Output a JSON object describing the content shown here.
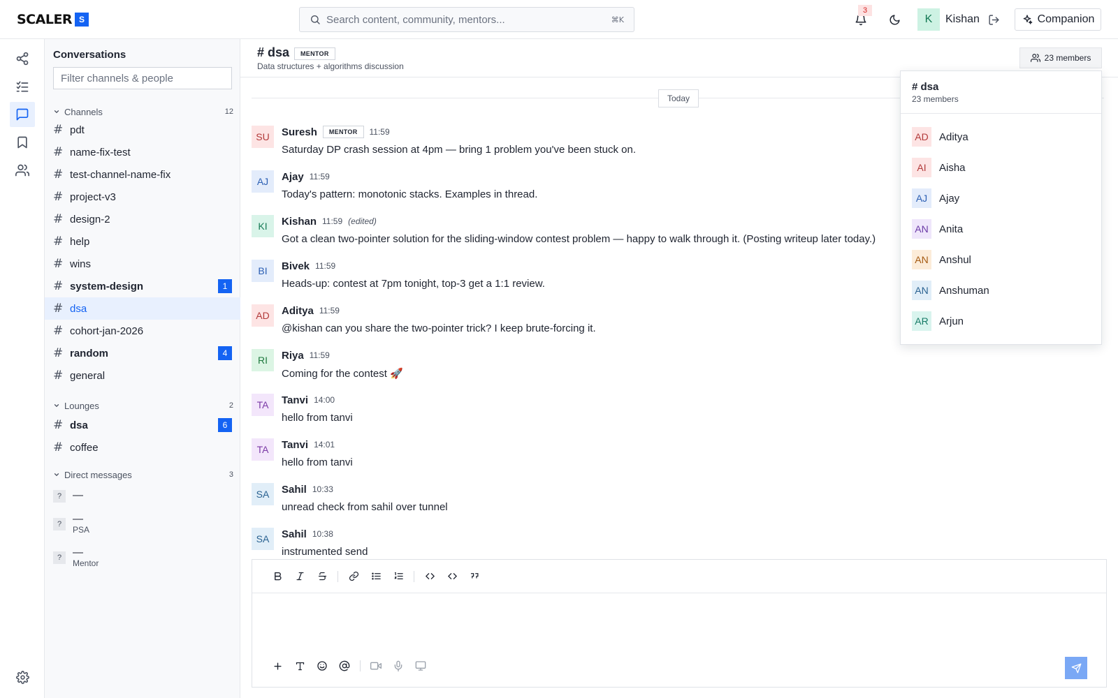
{
  "brand": {
    "name": "SCALER",
    "badge": "S",
    "accent": "#1463f3"
  },
  "search": {
    "placeholder": "Search content, community, mentors...",
    "shortcut": "⌘K"
  },
  "notifications": {
    "count": "3"
  },
  "user": {
    "initial": "K",
    "name": "Kishan"
  },
  "companion": {
    "label": "Companion"
  },
  "rail": {
    "items": [
      {
        "icon": "share-icon"
      },
      {
        "icon": "checklist-icon"
      },
      {
        "icon": "chat-icon",
        "active": true
      },
      {
        "icon": "bookmark-icon"
      },
      {
        "icon": "people-icon"
      }
    ],
    "settings_icon": "gear-icon"
  },
  "sidebar": {
    "title": "Conversations",
    "filter_placeholder": "Filter channels & people",
    "channels_section": {
      "label": "Channels",
      "count": "12"
    },
    "channels": [
      {
        "label": "pdt"
      },
      {
        "label": "name-fix-test"
      },
      {
        "label": "test-channel-name-fix"
      },
      {
        "label": "project-v3"
      },
      {
        "label": "design-2"
      },
      {
        "label": "help"
      },
      {
        "label": "wins"
      },
      {
        "label": "system-design",
        "unread": "1",
        "bold": true
      },
      {
        "label": "dsa",
        "active": true
      },
      {
        "label": "cohort-jan-2026"
      },
      {
        "label": "random",
        "unread": "4",
        "bold": true
      },
      {
        "label": "general"
      }
    ],
    "lounges_section": {
      "label": "Lounges",
      "count": "2"
    },
    "lounges": [
      {
        "label": "dsa",
        "unread": "6",
        "bold": true
      },
      {
        "label": "coffee"
      }
    ],
    "dms_section": {
      "label": "Direct messages",
      "count": "3"
    },
    "dms": [
      {
        "avatar": "?",
        "name": "—",
        "sub": ""
      },
      {
        "avatar": "?",
        "name": "—",
        "sub": "PSA"
      },
      {
        "avatar": "?",
        "name": "—",
        "sub": "Mentor"
      }
    ]
  },
  "channel": {
    "title": "# dsa",
    "tag": "MENTOR",
    "description": "Data structures + algorithms discussion",
    "members_button": "23 members",
    "date_divider": "Today"
  },
  "messages": [
    {
      "initials": "SU",
      "author": "Suresh",
      "tag": "MENTOR",
      "time": "11:59",
      "text": "Saturday DP crash session at 4pm — bring 1 problem you've been stuck on.",
      "bg": "#fde4e4",
      "fg": "#b23a3a"
    },
    {
      "initials": "AJ",
      "author": "Ajay",
      "time": "11:59",
      "text": "Today's pattern: monotonic stacks. Examples in thread.",
      "bg": "#e3ecfb",
      "fg": "#2c5fb3"
    },
    {
      "initials": "KI",
      "author": "Kishan",
      "time": "11:59",
      "edited": "(edited)",
      "text": "Got a clean two-pointer solution for the sliding-window contest problem — happy to walk through it. (Posting writeup later today.)",
      "bg": "#d9f4e9",
      "fg": "#167a55"
    },
    {
      "initials": "BI",
      "author": "Bivek",
      "time": "11:59",
      "text": "Heads-up: contest at 7pm tonight, top-3 get a 1:1 review.",
      "bg": "#e3ecfb",
      "fg": "#2c5fb3"
    },
    {
      "initials": "AD",
      "author": "Aditya",
      "time": "11:59",
      "text": "@kishan can you share the two-pointer trick? I keep brute-forcing it.",
      "bg": "#fde4e4",
      "fg": "#b23a3a"
    },
    {
      "initials": "RI",
      "author": "Riya",
      "time": "11:59",
      "text": "Coming for the contest 🚀",
      "bg": "#dcf5e4",
      "fg": "#1f7a3f"
    },
    {
      "initials": "TA",
      "author": "Tanvi",
      "time": "14:00",
      "text": "hello from tanvi",
      "bg": "#f3e6fb",
      "fg": "#7b3aa6"
    },
    {
      "initials": "TA",
      "author": "Tanvi",
      "time": "14:01",
      "text": "hello from tanvi",
      "bg": "#f3e6fb",
      "fg": "#7b3aa6"
    },
    {
      "initials": "SA",
      "author": "Sahil",
      "time": "10:33",
      "text": "unread check from sahil over tunnel",
      "bg": "#e1eef8",
      "fg": "#2a6291"
    },
    {
      "initials": "SA",
      "author": "Sahil",
      "time": "10:38",
      "text": "instrumented send",
      "bg": "#e1eef8",
      "fg": "#2a6291"
    }
  ],
  "composer": {
    "toolbar": [
      "bold-icon",
      "italic-icon",
      "strikethrough-icon",
      "link-icon",
      "bullet-list-icon",
      "numbered-list-icon",
      "code-icon",
      "code-block-icon",
      "quote-icon"
    ],
    "bottom": [
      "plus-icon",
      "text-format-icon",
      "emoji-icon",
      "mention-icon",
      "video-icon",
      "mic-icon",
      "screen-share-icon"
    ],
    "value": "",
    "send_icon": "send-icon"
  },
  "members_popover": {
    "title": "# dsa",
    "subtitle": "23 members",
    "members": [
      {
        "initials": "AD",
        "name": "Aditya",
        "bg": "#fde4e4",
        "fg": "#b23a3a"
      },
      {
        "initials": "AI",
        "name": "Aisha",
        "bg": "#fde4e4",
        "fg": "#b23a3a"
      },
      {
        "initials": "AJ",
        "name": "Ajay",
        "bg": "#e3ecfb",
        "fg": "#2c5fb3"
      },
      {
        "initials": "AN",
        "name": "Anita",
        "bg": "#efe6fb",
        "fg": "#6b3aa6"
      },
      {
        "initials": "AN",
        "name": "Anshul",
        "bg": "#fcecd9",
        "fg": "#a45a12"
      },
      {
        "initials": "AN",
        "name": "Anshuman",
        "bg": "#e1eef8",
        "fg": "#2a6291"
      },
      {
        "initials": "AR",
        "name": "Arjun",
        "bg": "#d9f4ee",
        "fg": "#167a66"
      }
    ]
  }
}
